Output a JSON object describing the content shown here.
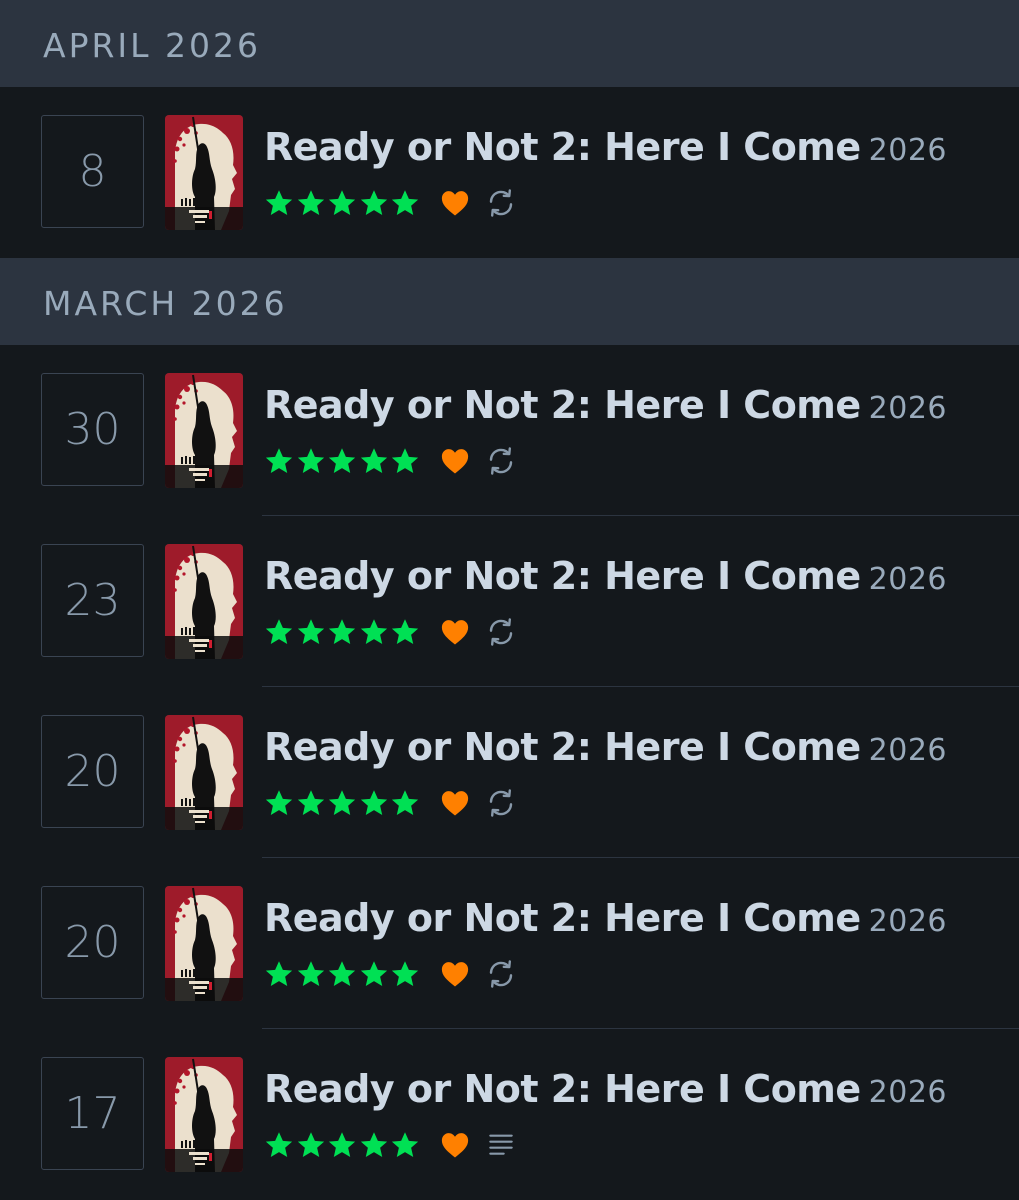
{
  "months": [
    {
      "title": "APRIL 2026",
      "entries": [
        {
          "day": "8",
          "title": "Ready or Not 2: Here I Come",
          "year": "2026",
          "rating": 5,
          "liked": true,
          "indicator": "rewatch-icon"
        }
      ]
    },
    {
      "title": "MARCH 2026",
      "entries": [
        {
          "day": "30",
          "title": "Ready or Not 2: Here I Come",
          "year": "2026",
          "rating": 5,
          "liked": true,
          "indicator": "rewatch-icon"
        },
        {
          "day": "23",
          "title": "Ready or Not 2: Here I Come",
          "year": "2026",
          "rating": 5,
          "liked": true,
          "indicator": "rewatch-icon"
        },
        {
          "day": "20",
          "title": "Ready or Not 2: Here I Come",
          "year": "2026",
          "rating": 5,
          "liked": true,
          "indicator": "rewatch-icon"
        },
        {
          "day": "20",
          "title": "Ready or Not 2: Here I Come",
          "year": "2026",
          "rating": 5,
          "liked": true,
          "indicator": "rewatch-icon"
        },
        {
          "day": "17",
          "title": "Ready or Not 2: Here I Come",
          "year": "2026",
          "rating": 5,
          "liked": true,
          "indicator": "review-icon"
        }
      ]
    }
  ],
  "colors": {
    "background": "#14181c",
    "header": "#2c3440",
    "star": "#40bcf4",
    "star_green": "#00e054",
    "heart": "#ff8000",
    "muted_icon": "#8899aa",
    "poster_red": "#9e1b2a",
    "poster_cream": "#ebe0cd"
  }
}
